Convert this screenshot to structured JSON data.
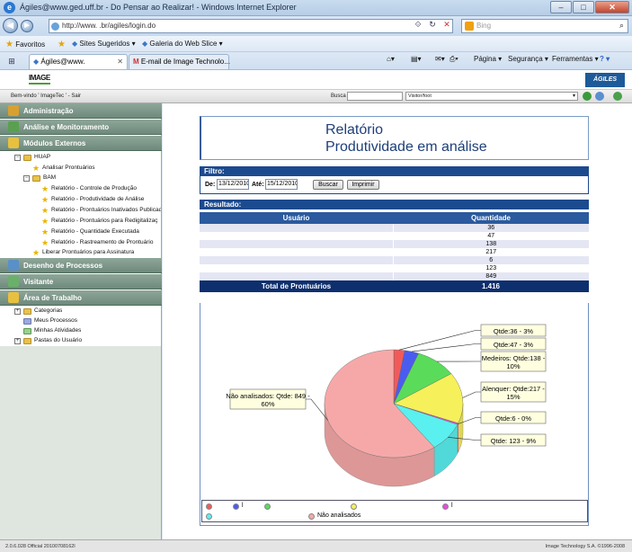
{
  "window": {
    "title": "Ágiles@www.ged.uff.br - Do Pensar ao Realizar! - Windows Internet Explorer",
    "url": "http://www.  .br/agiles/login.do",
    "search_placeholder": "Bing",
    "minimize": "–",
    "maximize": "□",
    "close": "✕"
  },
  "favorites": {
    "favoritos": "Favoritos",
    "sites": "Sites Sugeridos ▾",
    "galeria": "Galeria do Web Slice ▾"
  },
  "tabs": [
    {
      "label": "Ágiles@www.",
      "close": "✕"
    },
    {
      "label": "E-mail de Image Technolo..."
    }
  ],
  "commands": {
    "pagina": "Página ▾",
    "seguranca": "Segurança ▾",
    "ferramentas": "Ferramentas ▾",
    "help": "? ▾"
  },
  "app": {
    "logo": "IMAGE",
    "brand": "ÁGILES",
    "welcome": "Bem-vindo ' ImageTec '   -   Sair",
    "busca_label": "Busca",
    "visitor": "Visitor/foot"
  },
  "sidebar": {
    "sections": {
      "administracao": "Administração",
      "analise": "Análise e Monitoramento",
      "modulos": "Módulos Externos",
      "desenho": "Desenho de Processos",
      "visitante": "Visitante",
      "area": "Área de Trabalho"
    },
    "tree": {
      "huap": "HUAP",
      "analisar": "Analisar Prontuários",
      "bam": "BAM",
      "r1": "Relatório - Controle de Produção",
      "r2": "Relatório - Produtividade de Análise",
      "r3": "Relatório - Prontuários Inativados Publicad",
      "r4": "Relatório - Prontuários para Redigitalizaç",
      "r5": "Relatório - Quantidade Executada",
      "r6": "Relatório - Rastreamento de Prontuário",
      "liberar": "Liberar Prontuários para Assinatura",
      "categorias": "Categorias",
      "meus": "Meus Processos",
      "minhas": "Minhas Atividades",
      "pastas": "Pastas do Usuário"
    }
  },
  "report": {
    "title1": "Relatório",
    "title2": "Produtividade em análise",
    "filtro": "Filtro:",
    "de_label": "De:",
    "de_value": "13/12/2010",
    "ate_label": "Até:",
    "ate_value": "15/12/2010",
    "buscar": "Buscar",
    "imprimir": "Imprimir",
    "resultado": "Resultado:",
    "col_usuario": "Usuário",
    "col_quantidade": "Quantidade",
    "rows": [
      "36",
      "47",
      "138",
      "217",
      "6",
      "123",
      "849"
    ],
    "total_label": "Total de Prontuários",
    "total_value": "1.416"
  },
  "chart_data": {
    "type": "pie",
    "values": [
      36,
      47,
      138,
      217,
      6,
      123,
      849
    ],
    "colors": [
      "#f25a5a",
      "#4a5cf0",
      "#5adc5a",
      "#f6f05a",
      "#e84ae0",
      "#5af0f0",
      "#f6a8a8"
    ],
    "labels": [
      "Qtde:36 - 3%",
      "Qtde:47 - 3%",
      "Medeiros: Qtde:138 - 10%",
      "Alenquer: Qtde:217 - 15%",
      "Qtde:6 - 0%",
      "Qtde: 123 - 9%",
      "Não analisados: Qtde: 849 - 60%"
    ],
    "legend": [
      "",
      "l",
      "",
      "",
      "l",
      "",
      "Não analisados"
    ]
  },
  "status": {
    "left": "2.0.6.028 Official 20100708162l",
    "right": "Image Technology S.A. ©1996-2008"
  }
}
